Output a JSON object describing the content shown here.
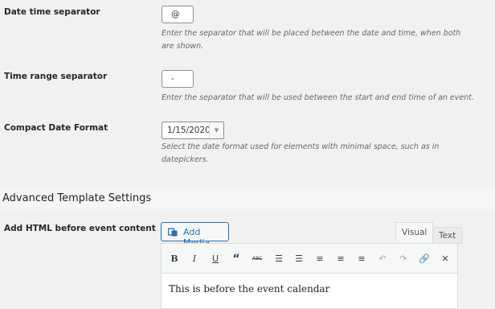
{
  "settings": {
    "date_time_separator": {
      "label": "Date time separator",
      "value": "@",
      "description_line1": "Enter the separator that will be placed between the date and time, when both",
      "description_line2": "are shown."
    },
    "time_range_separator": {
      "label": "Time range separator",
      "value": "-",
      "description": "Enter the separator that will be used between the start and end time of an event."
    },
    "compact_date_format": {
      "label": "Compact Date Format",
      "value": "1/15/2020",
      "description_line1": "Select the date format used for elements with minimal space, such as in",
      "description_line2": "datepickers."
    }
  },
  "section": {
    "title": "Advanced Template Settings"
  },
  "html_before": {
    "label": "Add HTML before event content",
    "add_media_label": "Add Media",
    "tab_visual": "Visual",
    "tab_text": "Text",
    "toolbar": [
      "bold-icon",
      "italic-icon",
      "underline-icon",
      "blockquote-icon",
      "strikethrough-icon",
      "bullet-list-icon",
      "numbered-list-icon",
      "align-left-icon",
      "align-center-icon",
      "align-right-icon",
      "undo-icon",
      "redo-icon",
      "link-icon",
      "fullscreen-icon"
    ],
    "editor_content": "This is before the event calendar"
  }
}
